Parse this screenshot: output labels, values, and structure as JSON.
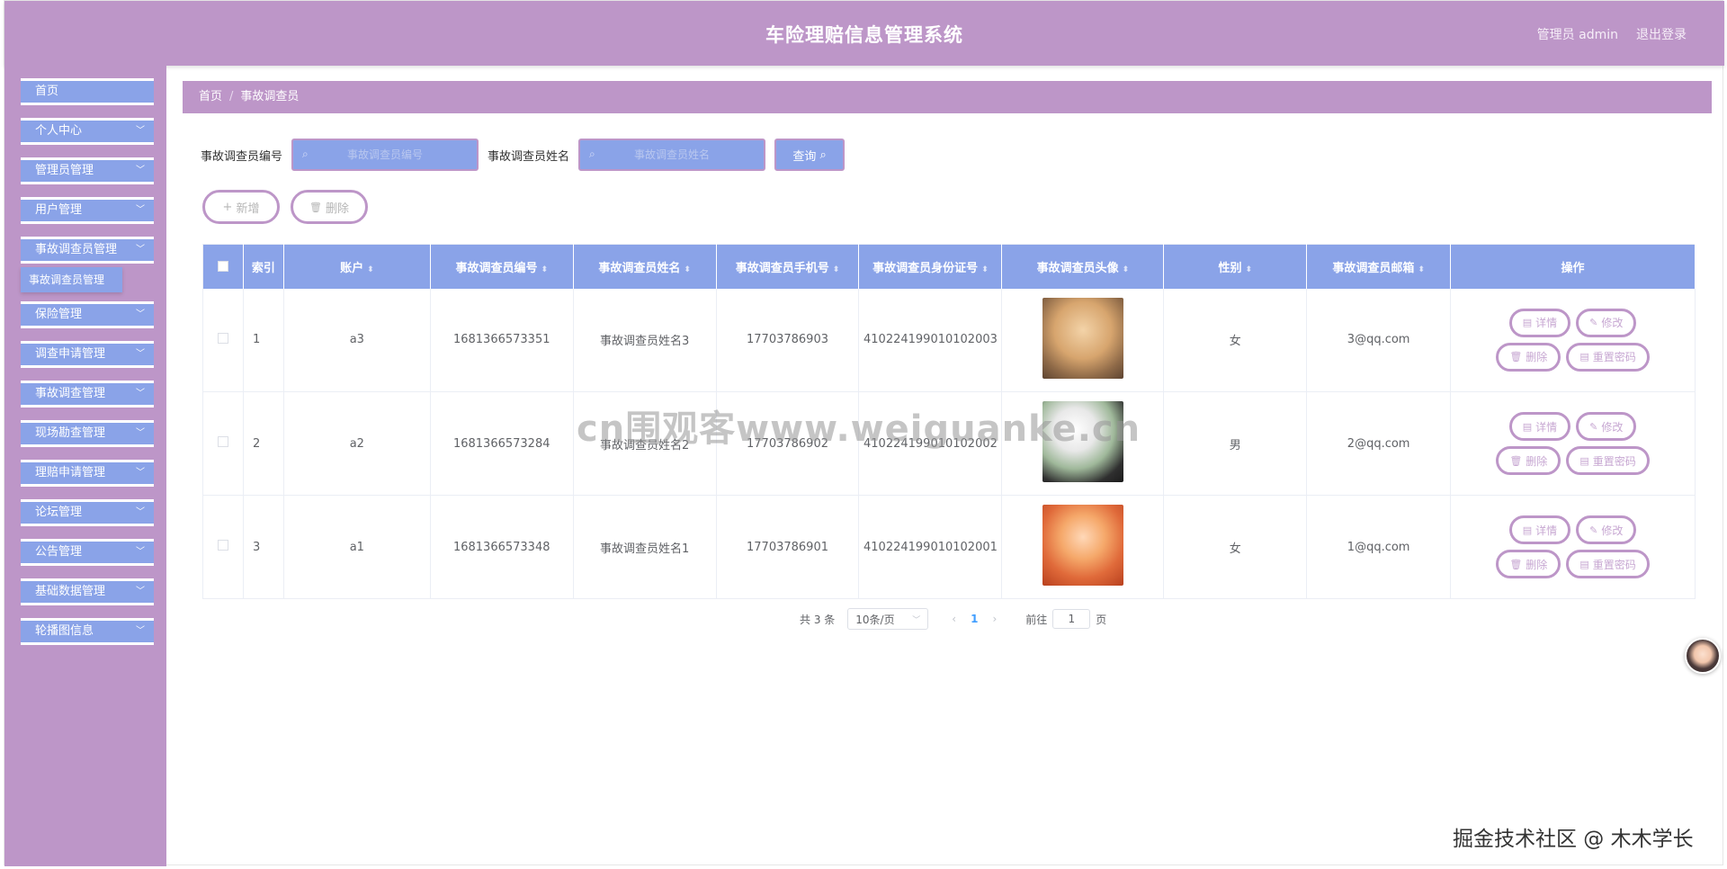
{
  "header": {
    "title": "车险理赔信息管理系统",
    "user": "管理员 admin",
    "logout": "退出登录"
  },
  "sidebar": {
    "items": [
      {
        "label": "首页",
        "chevron": false
      },
      {
        "label": "个人中心",
        "chevron": true
      },
      {
        "label": "管理员管理",
        "chevron": true
      },
      {
        "label": "用户管理",
        "chevron": true
      },
      {
        "label": "事故调查员管理",
        "chevron": true
      },
      {
        "label": "保险管理",
        "chevron": true
      },
      {
        "label": "调查申请管理",
        "chevron": true
      },
      {
        "label": "事故调查管理",
        "chevron": true
      },
      {
        "label": "现场勘查管理",
        "chevron": true
      },
      {
        "label": "理赔申请管理",
        "chevron": true
      },
      {
        "label": "论坛管理",
        "chevron": true
      },
      {
        "label": "公告管理",
        "chevron": true
      },
      {
        "label": "基础数据管理",
        "chevron": true
      },
      {
        "label": "轮播图信息",
        "chevron": true
      }
    ],
    "submenu_label": "事故调查员管理",
    "chevron_glyph": "﹀"
  },
  "breadcrumb": {
    "home": "首页",
    "sep": "/",
    "current": "事故调查员"
  },
  "search": {
    "id_label": "事故调查员编号",
    "id_placeholder": "事故调查员编号",
    "name_label": "事故调查员姓名",
    "name_placeholder": "事故调查员姓名",
    "query_label": "查询",
    "search_glyph": "⌕"
  },
  "actions": {
    "add_label": "新增",
    "add_glyph": "+",
    "delete_label": "删除",
    "delete_glyph": "🗑"
  },
  "table": {
    "headers": [
      "索引",
      "账户",
      "事故调查员编号",
      "事故调查员姓名",
      "事故调查员手机号",
      "事故调查员身份证号",
      "事故调查员头像",
      "性别",
      "事故调查员邮箱",
      "操作"
    ],
    "sort_glyph": "⬍",
    "rows": [
      {
        "index": "1",
        "account": "a3",
        "number": "1681366573351",
        "name": "事故调查员姓名3",
        "phone": "17703786903",
        "idcard": "410224199010102003",
        "gender": "女",
        "email": "3@qq.com"
      },
      {
        "index": "2",
        "account": "a2",
        "number": "1681366573284",
        "name": "事故调查员姓名2",
        "phone": "17703786902",
        "idcard": "410224199010102002",
        "gender": "男",
        "email": "2@qq.com"
      },
      {
        "index": "3",
        "account": "a1",
        "number": "1681366573348",
        "name": "事故调查员姓名1",
        "phone": "17703786901",
        "idcard": "410224199010102001",
        "gender": "女",
        "email": "1@qq.com"
      }
    ],
    "ops": {
      "detail": "详情",
      "edit": "修改",
      "delete": "删除",
      "reset": "重置密码"
    }
  },
  "pager": {
    "total": "共 3 条",
    "size": "10条/页",
    "prev": "‹",
    "current": "1",
    "next": "›",
    "goto_before": "前往",
    "goto_value": "1",
    "goto_after": "页"
  },
  "watermarks": {
    "center": "cn围观客www.weiguanke.cn",
    "corner": "掘金技术社区 @ 木木学长"
  },
  "colors": {
    "header": "#bd96c8",
    "accent": "#8aa3e8"
  }
}
